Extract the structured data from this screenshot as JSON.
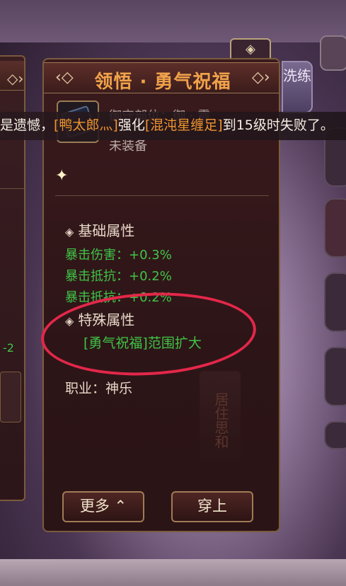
{
  "panel": {
    "title": "领悟 · 勇气祝福",
    "side_tab": "洗练",
    "item_name": "御守部位：御 · 霞",
    "item_status": "未装备",
    "basic_section": "基础属性",
    "attributes": [
      "暴击伤害：+0.3%",
      "暴击抵抗：+0.2%",
      "暴击抵抗：+0.2%"
    ],
    "special_section": "特殊属性",
    "special_value": "[勇气祝福]范围扩大",
    "job": "职业：神乐",
    "more_button": "更多",
    "wear_button": "穿上"
  },
  "notice": {
    "prefix": "是遗憾，",
    "player": "[鸭太郎灬]",
    "mid": "强化",
    "item": "[混沌星缠足]",
    "suffix": "到15级时失败了。"
  },
  "left_panel": {
    "value": "-2"
  },
  "banner": {
    "icon": "◈"
  },
  "scroll_text": "居住思和",
  "colors": {
    "accent_orange": "#f0a24a",
    "attribute_green": "#3fc447",
    "annotation_red": "#e3274a"
  },
  "icons": {
    "prev": "chevron-left-icon",
    "next": "chevron-right-icon",
    "sparkle": "sparkle-icon",
    "diamond": "diamond-bullet-icon",
    "up": "chevron-up-icon"
  }
}
